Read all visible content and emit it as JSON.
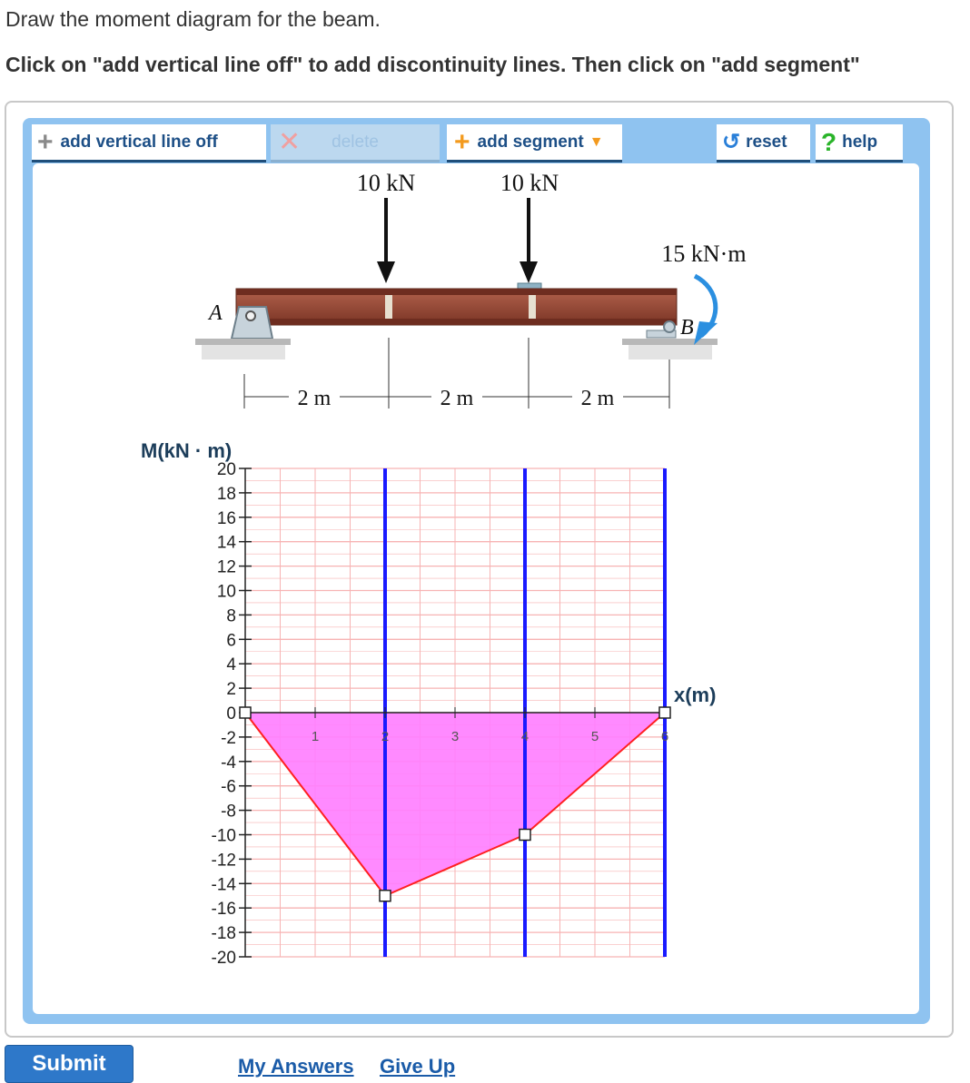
{
  "instructions": {
    "line1": "Draw the moment diagram for the beam.",
    "line2": "Click on \"add vertical line off\" to add discontinuity lines. Then click on \"add segment\""
  },
  "toolbar": {
    "add_vertical_line_label": "add vertical line off",
    "delete_label": "delete",
    "add_segment_label": "add segment",
    "reset_label": "reset",
    "help_label": "help"
  },
  "beam": {
    "load1": "10 kN",
    "load2": "10 kN",
    "moment": "15 kN·m",
    "support_a": "A",
    "support_b": "B",
    "dim1": "2 m",
    "dim2": "2 m",
    "dim3": "2 m"
  },
  "chart_data": {
    "type": "line",
    "ylabel": "M(kN · m)",
    "xlabel": "x(m)",
    "xlim": [
      0,
      6
    ],
    "ylim": [
      -20,
      20
    ],
    "x_ticks": [
      "1",
      "2",
      "3",
      "4",
      "5",
      "6"
    ],
    "y_ticks": [
      "20",
      "18",
      "16",
      "14",
      "12",
      "10",
      "8",
      "6",
      "4",
      "2",
      "0",
      "-2",
      "-4",
      "-6",
      "-8",
      "-10",
      "-12",
      "-14",
      "-16",
      "-18",
      "-20"
    ],
    "discontinuity_lines_x": [
      2,
      4,
      6
    ],
    "points": [
      {
        "x": 0,
        "y": 0
      },
      {
        "x": 2,
        "y": -15
      },
      {
        "x": 4,
        "y": -10
      },
      {
        "x": 6,
        "y": 0
      }
    ],
    "colors": {
      "segment": "#ff2020",
      "fill": "#ff7dff",
      "discontinuity": "#1a1aff",
      "grid": "#f7b3b3"
    }
  },
  "footer": {
    "submit_label": "Submit",
    "my_answers_label": "My Answers",
    "give_up_label": "Give Up"
  }
}
